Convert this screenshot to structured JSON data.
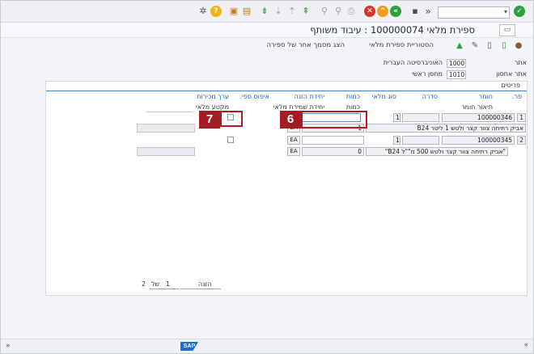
{
  "toolbar": {
    "command_field_value": "",
    "icons": [
      "checkmark-icon",
      "back-icon",
      "exit-icon",
      "cancel-icon",
      "print-icon",
      "find-icon",
      "find-next-icon",
      "first-page-icon",
      "prev-page-icon",
      "next-page-icon",
      "last-page-icon",
      "new-session-icon",
      "shortcut-icon",
      "help-icon",
      "customize-icon"
    ],
    "colors": {
      "green": "#2e9e3e",
      "orange": "#f39a1e",
      "red": "#d7342c",
      "yellow": "#f2b21a"
    }
  },
  "title": {
    "text": "ספירת מלאי 100000074 : עיבוד משותף"
  },
  "app_toolbar": {
    "items": [
      {
        "label": "הסטוריית ספירת מלאי"
      },
      {
        "label": "הצג מסמך אחר של ספירה"
      }
    ]
  },
  "header": {
    "site_label": "אתר",
    "site_code": "1000",
    "site_name": "האוניברסיטה העברית",
    "storage_label": "אתר אחסון",
    "storage_code": "1010",
    "storage_name": "מחסן ראשי"
  },
  "items": {
    "section_title": "פריטים",
    "columns": {
      "item": "פר.",
      "material": "חומר",
      "batch": "סדרה",
      "stock_type": "סוג מלאי",
      "quantity": "כמות",
      "entry_unit": "יחידת הזנה",
      "zero_count": "איפוס ספי.",
      "sales_value": "ערך מכירות"
    },
    "subcolumns": {
      "material_desc": "תיאור חומר",
      "quantity": "כמות",
      "storage_unit": "יחידת שמירת מלאי",
      "stock_segment": "מקטע מלאי"
    },
    "rows": [
      {
        "item": "1",
        "material": "100000346",
        "stock_type": "1",
        "quantity_input": "",
        "description": "אביק רתיחה צוור קצר ולטש 1 ליטר B24",
        "booked_qty": "1",
        "unit": "EA"
      },
      {
        "item": "2",
        "material": "100000345",
        "stock_type": "1",
        "quantity_input": "",
        "description": "\"אביק רתיחה צוור קצר ולטש 500 מ\"\"ל B24\"",
        "booked_qty": "0",
        "unit": "EA"
      }
    ],
    "pager": {
      "entry_label": "הזנה",
      "current": "1",
      "of_label": "של",
      "total": "2"
    }
  },
  "callouts": {
    "quantity": "6",
    "zero_count": "7"
  },
  "status": {
    "left_symbol": "»",
    "right_symbol": "«",
    "logo": "SAP"
  }
}
